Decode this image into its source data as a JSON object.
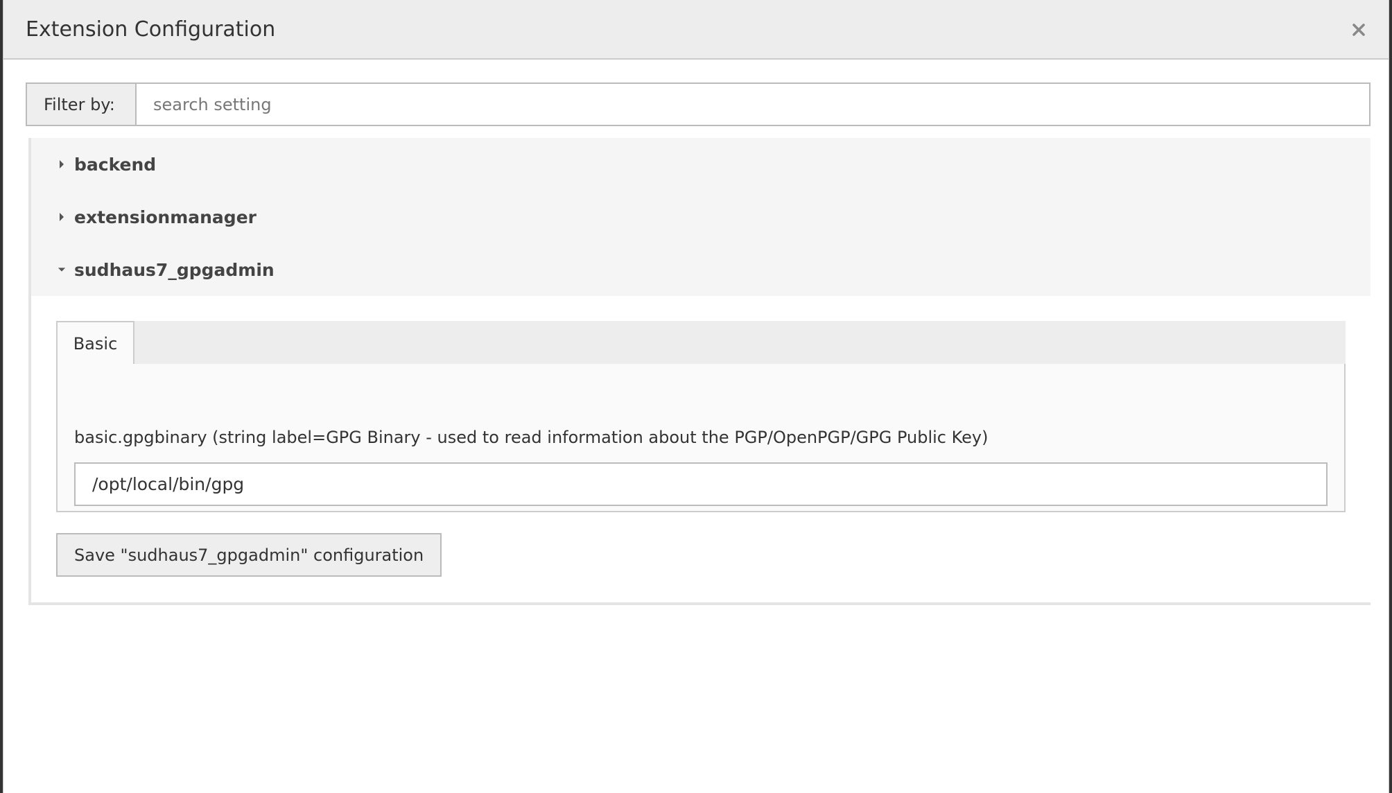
{
  "dialog": {
    "title": "Extension Configuration",
    "close_icon": "close-icon"
  },
  "filter": {
    "label": "Filter by:",
    "placeholder": "search setting",
    "value": ""
  },
  "panels": [
    {
      "label": "backend",
      "expanded": false,
      "icon": "caret-right-icon"
    },
    {
      "label": "extensionmanager",
      "expanded": false,
      "icon": "caret-right-icon"
    },
    {
      "label": "sudhaus7_gpgadmin",
      "expanded": true,
      "icon": "caret-down-icon"
    }
  ],
  "expanded_panel": {
    "tabs": [
      {
        "label": "Basic",
        "active": true
      }
    ],
    "setting": {
      "label": "basic.gpgbinary (string label=GPG Binary - used to read information about the PGP/OpenPGP/GPG Public Key)",
      "value": "/opt/local/bin/gpg"
    },
    "save_label": "Save \"sudhaus7_gpgadmin\" configuration"
  },
  "colors": {
    "header_bg": "#ededed",
    "panel_bg": "#f5f5f5",
    "text": "#333333",
    "border": "#bbbbbb"
  }
}
